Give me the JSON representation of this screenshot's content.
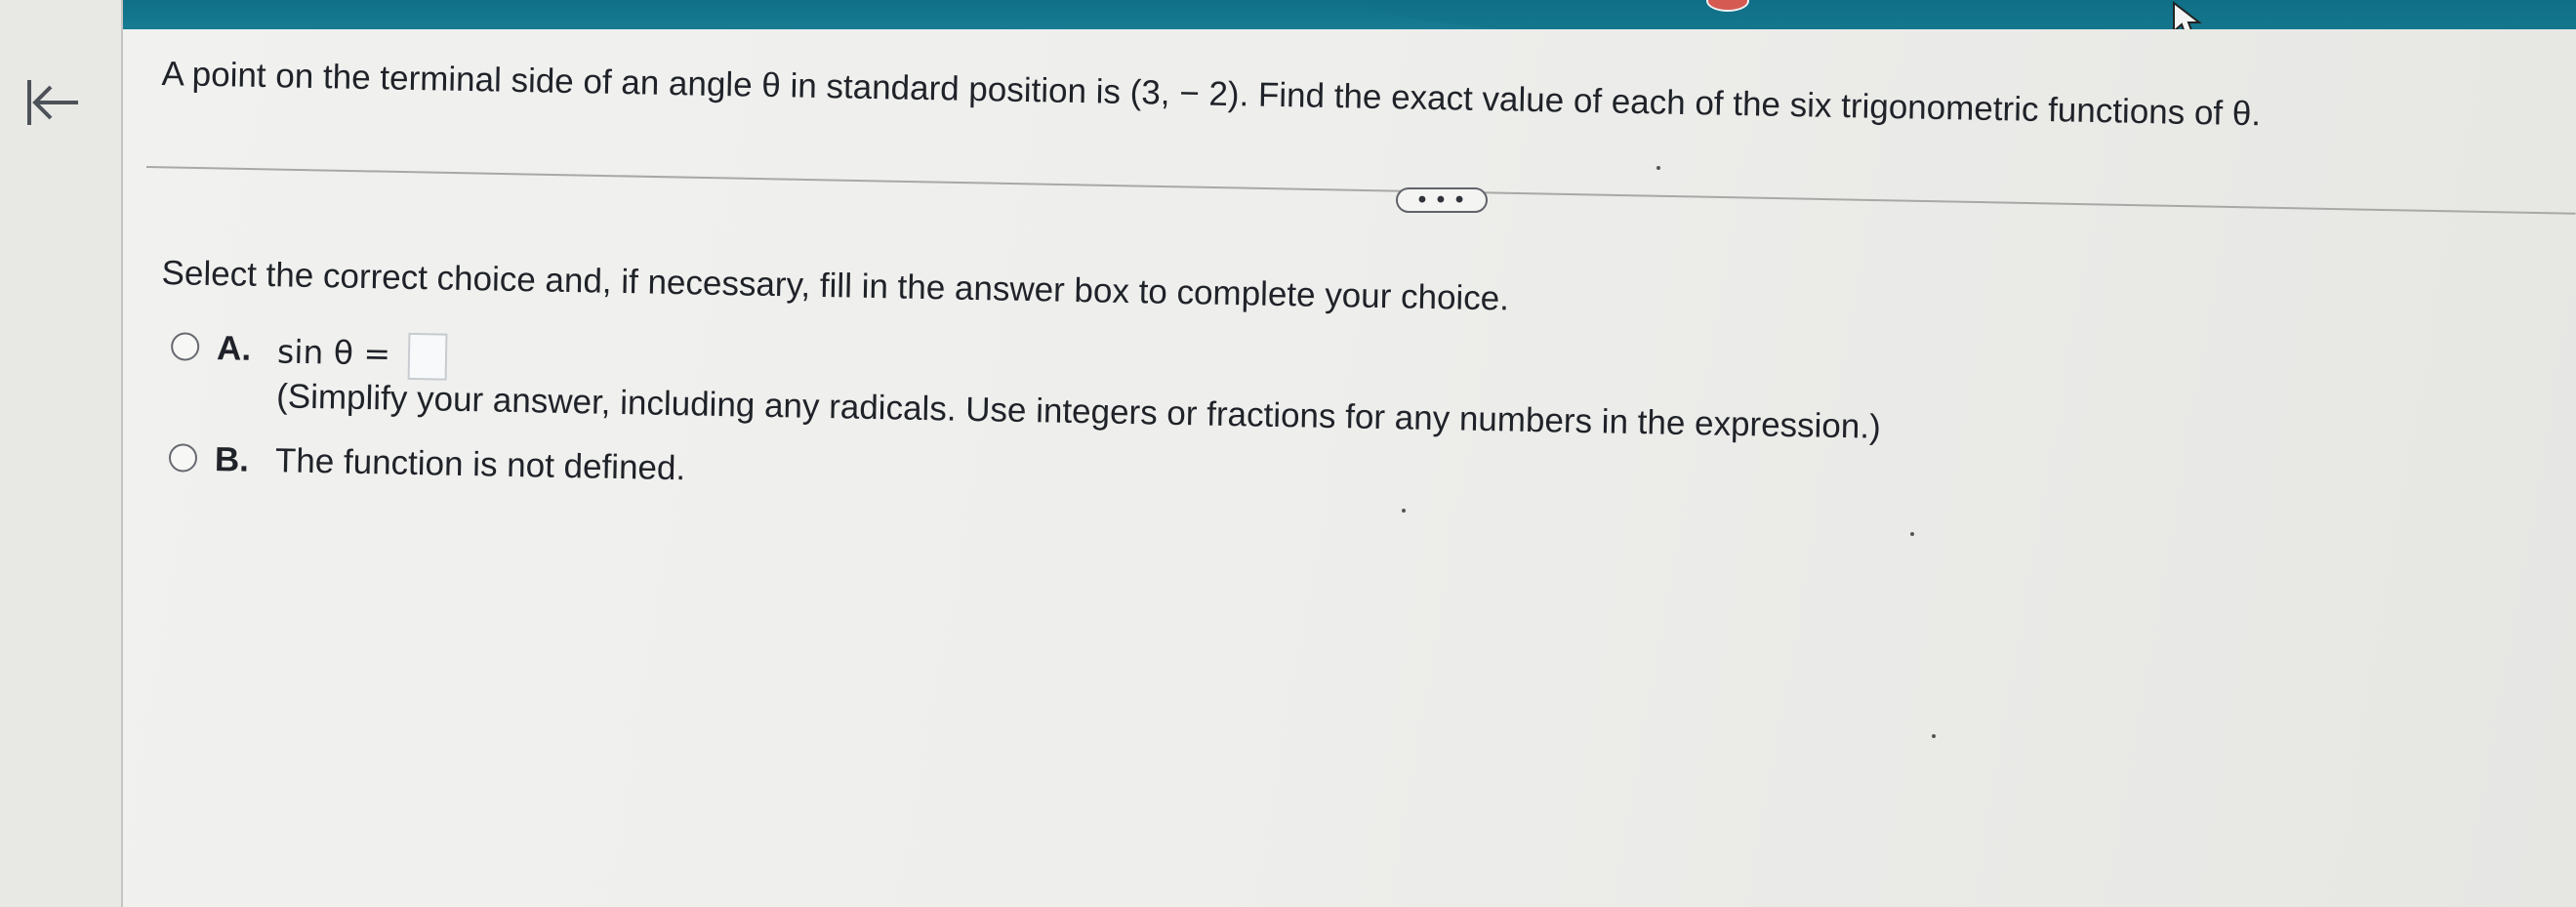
{
  "header": {
    "accent_color": "#177c93"
  },
  "navigation": {
    "back_icon": "back-to-start-icon"
  },
  "question": {
    "text": "A point on the terminal side of an angle θ in standard position is (3, − 2). Find the exact value of each of the six trigonometric functions of θ."
  },
  "more_button": {
    "label": "• • •"
  },
  "prompt": {
    "instruction": "Select the correct choice and, if necessary, fill in the answer box to complete your choice."
  },
  "choices": [
    {
      "letter": "A.",
      "expression": "sin θ =",
      "answer_value": "",
      "hint": "(Simplify your answer, including any radicals. Use integers or fractions for any numbers in the expression.)"
    },
    {
      "letter": "B.",
      "text": "The function is not defined."
    }
  ]
}
